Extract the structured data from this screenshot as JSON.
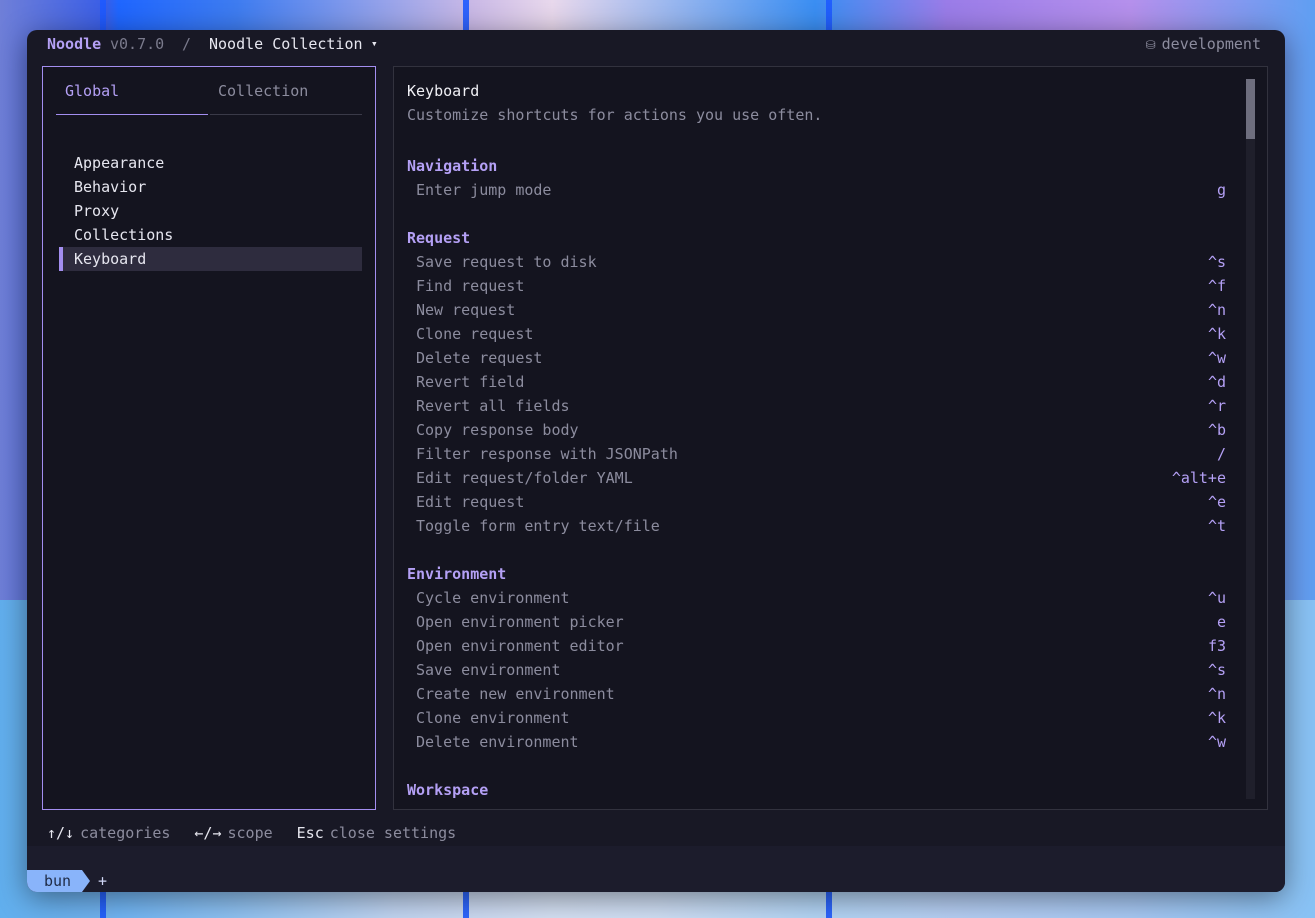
{
  "window": {
    "app_name": "Noodle",
    "app_version": "v0.7.0",
    "separator": "/",
    "collection_name": "Noodle Collection",
    "collection_caret": "▾",
    "environment_icon": "⛁",
    "environment": "development"
  },
  "tabs": [
    {
      "label": "Global",
      "active": true
    },
    {
      "label": "Collection",
      "active": false
    }
  ],
  "categories": [
    {
      "label": "Appearance"
    },
    {
      "label": "Behavior"
    },
    {
      "label": "Proxy"
    },
    {
      "label": "Collections"
    },
    {
      "label": "Keyboard",
      "selected": true
    }
  ],
  "content": {
    "title": "Keyboard",
    "description": "Customize shortcuts for actions you use often.",
    "sections": [
      {
        "name": "Navigation",
        "rows": [
          {
            "label": "Enter jump mode",
            "key": "g"
          }
        ]
      },
      {
        "name": "Request",
        "rows": [
          {
            "label": "Save request to disk",
            "key": "^s"
          },
          {
            "label": "Find request",
            "key": "^f"
          },
          {
            "label": "New request",
            "key": "^n"
          },
          {
            "label": "Clone request",
            "key": "^k"
          },
          {
            "label": "Delete request",
            "key": "^w"
          },
          {
            "label": "Revert field",
            "key": "^d"
          },
          {
            "label": "Revert all fields",
            "key": "^r"
          },
          {
            "label": "Copy response body",
            "key": "^b"
          },
          {
            "label": "Filter response with JSONPath",
            "key": "/"
          },
          {
            "label": "Edit request/folder YAML",
            "key": "^alt+e"
          },
          {
            "label": "Edit request",
            "key": "^e"
          },
          {
            "label": "Toggle form entry text/file",
            "key": "^t"
          }
        ]
      },
      {
        "name": "Environment",
        "rows": [
          {
            "label": "Cycle environment",
            "key": "^u"
          },
          {
            "label": "Open environment picker",
            "key": "e"
          },
          {
            "label": "Open environment editor",
            "key": "f3"
          },
          {
            "label": "Save environment",
            "key": "^s"
          },
          {
            "label": "Create new environment",
            "key": "^n"
          },
          {
            "label": "Clone environment",
            "key": "^k"
          },
          {
            "label": "Delete environment",
            "key": "^w"
          }
        ]
      },
      {
        "name": "Workspace",
        "rows": []
      }
    ]
  },
  "hints": [
    {
      "key": "↑/↓",
      "text": "categories"
    },
    {
      "key": "←/→",
      "text": "scope"
    },
    {
      "key": "Esc",
      "text": "close settings"
    }
  ],
  "terminal": {
    "tab_label": "bun",
    "new_tab": "+"
  },
  "colors": {
    "accent": "#b4a0f5",
    "border_active": "#a38ef0",
    "window_bg": "#181825",
    "terminal_tab": "#89b4fa"
  }
}
